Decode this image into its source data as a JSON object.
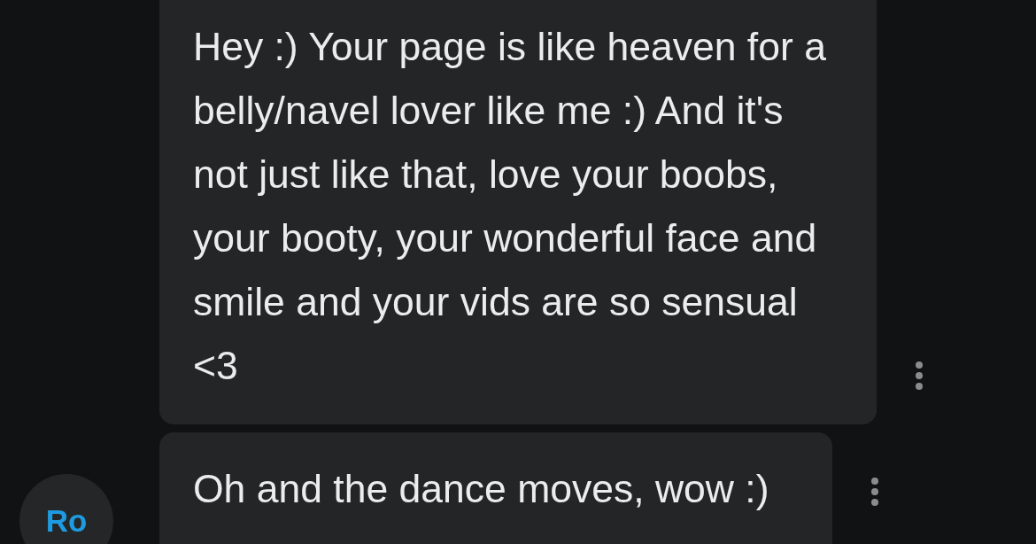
{
  "messages": [
    {
      "text": "Hey :) Your page is like heaven for a belly/navel lover like me :) And it's not just like that, love your boobs, your booty, your wonderful face and smile and your vids are so sensual <3"
    },
    {
      "text": "Oh and the dance moves, wow :)",
      "avatar": "Ro"
    }
  ]
}
